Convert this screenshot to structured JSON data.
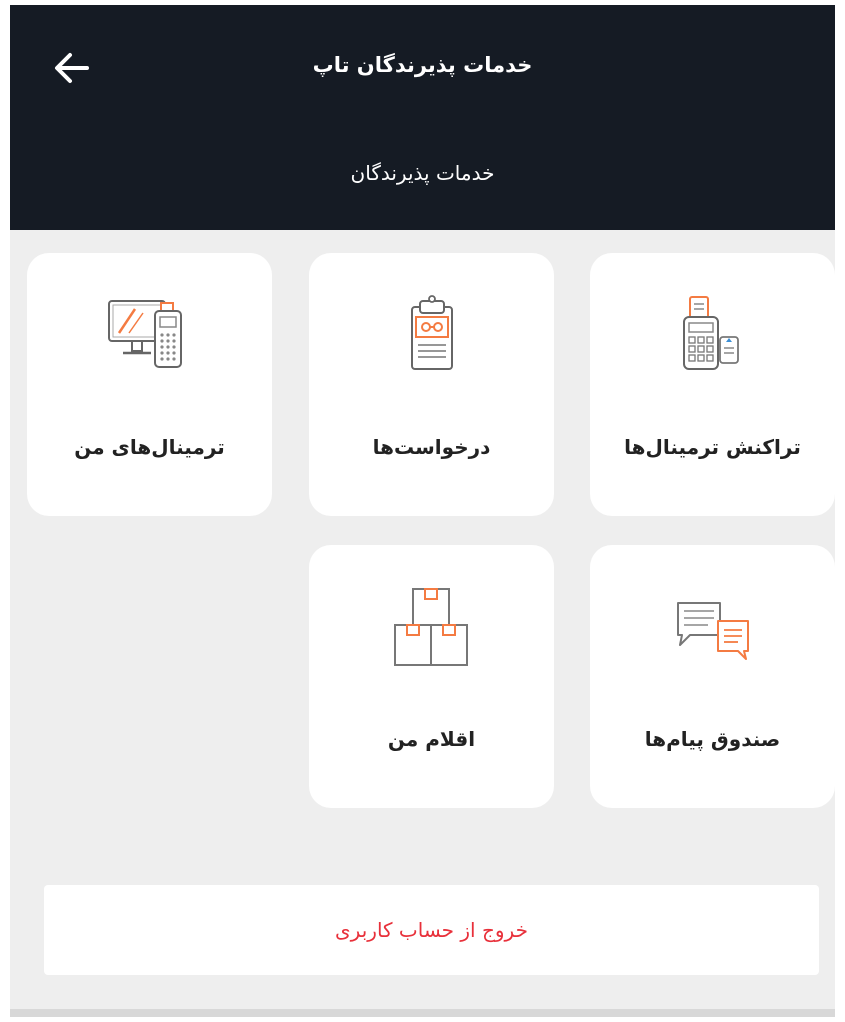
{
  "header": {
    "app_title": "خدمات پذیرندگان تاپ",
    "section_title": "خدمات پذیرندگان",
    "back_icon": "arrow-left-icon"
  },
  "cards": [
    {
      "label": "تراکنش ترمینال‌ها",
      "icon": "pos-terminal-icon"
    },
    {
      "label": "درخواست‌ها",
      "icon": "clipboard-icon"
    },
    {
      "label": "ترمینال‌های من",
      "icon": "computer-pos-icon"
    },
    {
      "label": "صندوق پیام‌ها",
      "icon": "chat-messages-icon"
    },
    {
      "label": "اقلام من",
      "icon": "boxes-icon"
    }
  ],
  "logout": {
    "label": "خروج از حساب کاربری"
  },
  "colors": {
    "header_bg": "#151b24",
    "accent": "#f47b42",
    "logout_text": "#e8303a",
    "background": "#eeeeee"
  }
}
